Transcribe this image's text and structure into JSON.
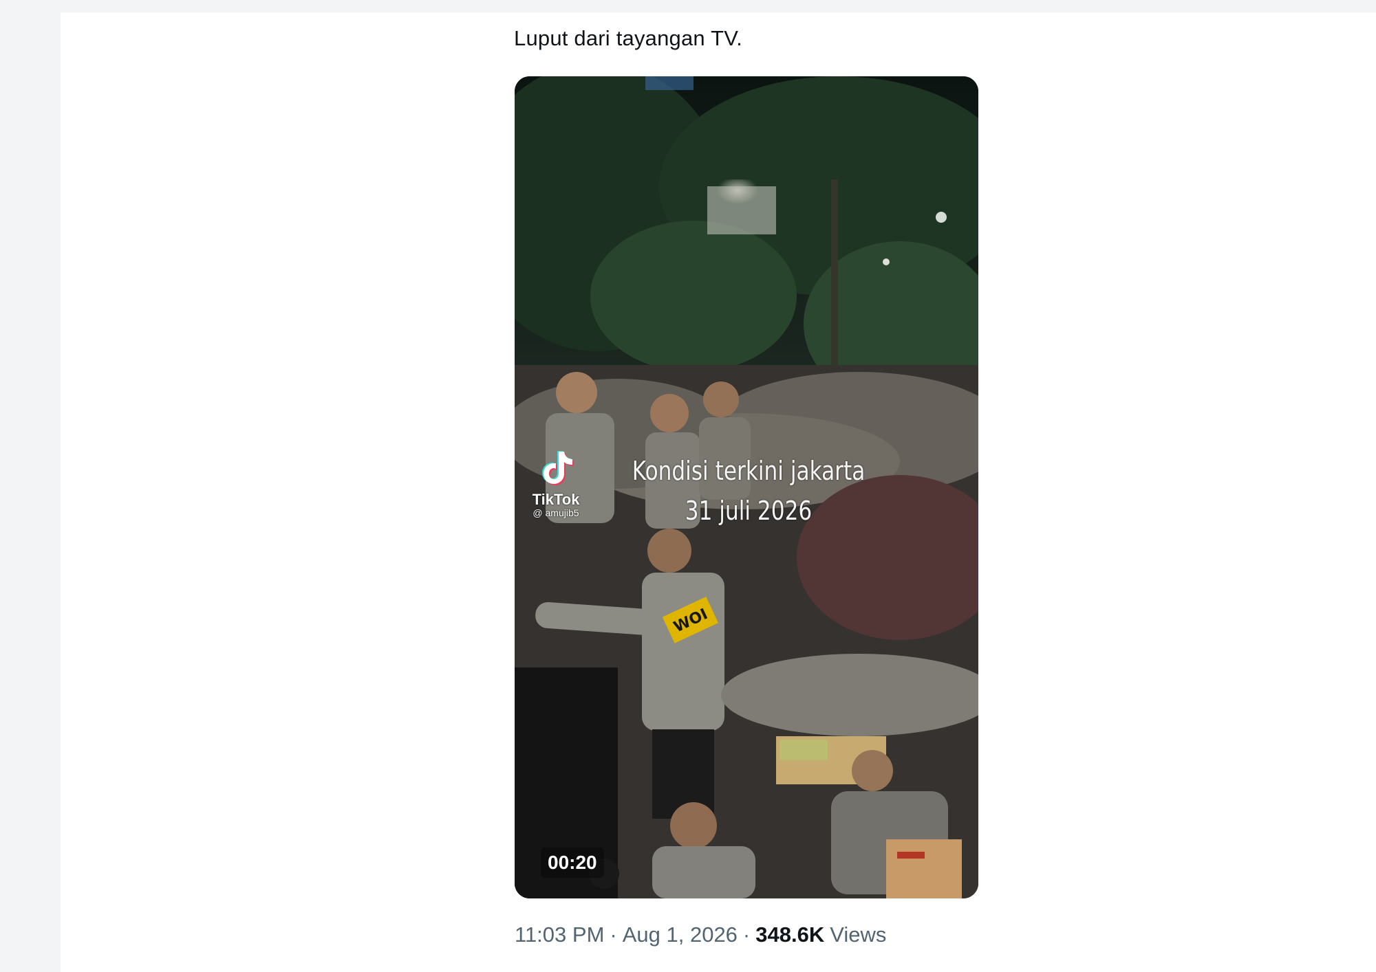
{
  "tweet": {
    "text": "Luput dari tayangan TV.",
    "time": "11:03 PM",
    "separator": "·",
    "date": "Aug 1, 2026",
    "views_count": "348.6K",
    "views_label": "Views"
  },
  "video": {
    "overlay_line1": "Kondisi terkini jakarta",
    "overlay_line2": "31 juli 2026",
    "duration": "00:20",
    "watermark_brand": "TikTok",
    "watermark_handle": "@ amujib5",
    "armband_text": "WOI"
  },
  "colors": {
    "text_primary": "#0f1419",
    "text_secondary": "#536471",
    "background": "#ffffff",
    "uniform": "#8d8b84"
  }
}
